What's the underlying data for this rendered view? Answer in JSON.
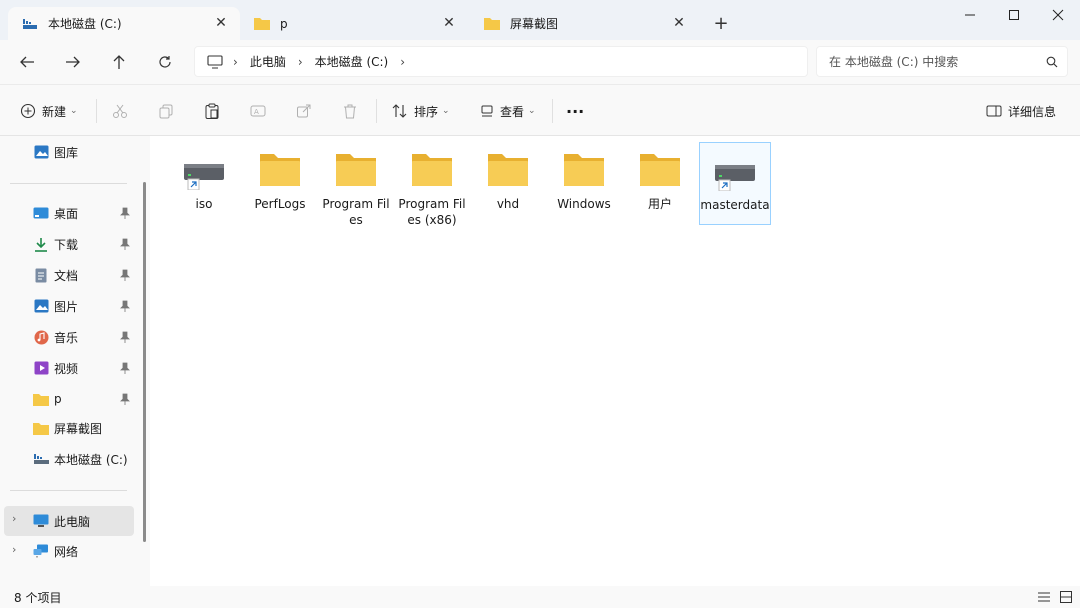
{
  "tabs": [
    {
      "label": "本地磁盘 (C:)",
      "icon": "drive-icon",
      "active": true
    },
    {
      "label": "p",
      "icon": "folder-icon",
      "active": false
    },
    {
      "label": "屏幕截图",
      "icon": "folder-icon",
      "active": false
    }
  ],
  "window": {
    "new_tab": "+",
    "minimize": "minimize-icon",
    "maximize": "maximize-icon",
    "close": "close-icon"
  },
  "nav": {
    "breadcrumb": [
      "此电脑",
      "本地磁盘 (C:)"
    ],
    "search_placeholder": "在 本地磁盘 (C:) 中搜索"
  },
  "command_bar": {
    "new_label": "新建",
    "sort_label": "排序",
    "view_label": "查看",
    "more_label": "···",
    "details_label": "详细信息"
  },
  "sidebar": {
    "gallery": "图库",
    "quick_access": [
      {
        "label": "桌面",
        "icon": "desktop-icon",
        "pinned": true
      },
      {
        "label": "下载",
        "icon": "download-icon",
        "pinned": true
      },
      {
        "label": "文档",
        "icon": "documents-icon",
        "pinned": true
      },
      {
        "label": "图片",
        "icon": "pictures-icon",
        "pinned": true
      },
      {
        "label": "音乐",
        "icon": "music-icon",
        "pinned": true
      },
      {
        "label": "视频",
        "icon": "videos-icon",
        "pinned": true
      },
      {
        "label": "p",
        "icon": "folder-icon",
        "pinned": true
      },
      {
        "label": "屏幕截图",
        "icon": "folder-icon",
        "pinned": false
      },
      {
        "label": "本地磁盘 (C:)",
        "icon": "drive-icon",
        "pinned": false
      }
    ],
    "this_pc": "此电脑",
    "network": "网络"
  },
  "items": [
    {
      "name": "iso",
      "type": "drive-shortcut"
    },
    {
      "name": "PerfLogs",
      "type": "folder"
    },
    {
      "name": "Program Files",
      "type": "folder"
    },
    {
      "name": "Program Files (x86)",
      "type": "folder"
    },
    {
      "name": "vhd",
      "type": "folder"
    },
    {
      "name": "Windows",
      "type": "folder"
    },
    {
      "name": "用户",
      "type": "folder"
    },
    {
      "name": "masterdata",
      "type": "drive-shortcut",
      "selected": true
    }
  ],
  "status": {
    "count": "8 个项目"
  },
  "colors": {
    "folder": "#f5c847",
    "accent": "#0067c0",
    "selection_border": "#99d1ff"
  }
}
